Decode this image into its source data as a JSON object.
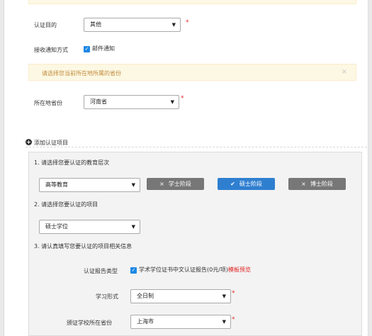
{
  "form": {
    "purpose": {
      "label": "认证目的",
      "value": "其他",
      "required_mark": "*"
    },
    "notify": {
      "label": "接收通知方式",
      "option": "邮件通知",
      "checked": true
    },
    "province_alert": {
      "text": "请选择您当前所在地所属的省份",
      "close": "×"
    },
    "province": {
      "label": "所在地省份",
      "value": "河南省",
      "required_mark": "*"
    }
  },
  "add_item": {
    "label": "添加认证项目"
  },
  "panel": {
    "step1": "1. 请选择您要认证的教育层次",
    "edu_level": "高等教育",
    "stages": [
      {
        "icon": "×",
        "label": "学士阶段",
        "selected": false
      },
      {
        "icon": "✔",
        "label": "硕士阶段",
        "selected": true
      },
      {
        "icon": "×",
        "label": "博士阶段",
        "selected": false
      }
    ],
    "step2": "2. 请选择您要认证的项目",
    "item": "硕士学位",
    "step3": "3. 请认真填写您要认证的项目相关信息",
    "report_type": {
      "label": "认证报告类型",
      "option": "学术学位证书中文认证报告(0元/项)",
      "link": "模板预览"
    },
    "study_form": {
      "label": "学习形式",
      "value": "全日制",
      "required_mark": "*"
    },
    "school_province": {
      "label": "颁证学校所在省份",
      "value": "上海市",
      "required_mark": "*"
    }
  },
  "colors": {
    "accent": "#2f7fd0",
    "alert_bg": "#fcf8e3",
    "required": "#e32d2d"
  }
}
